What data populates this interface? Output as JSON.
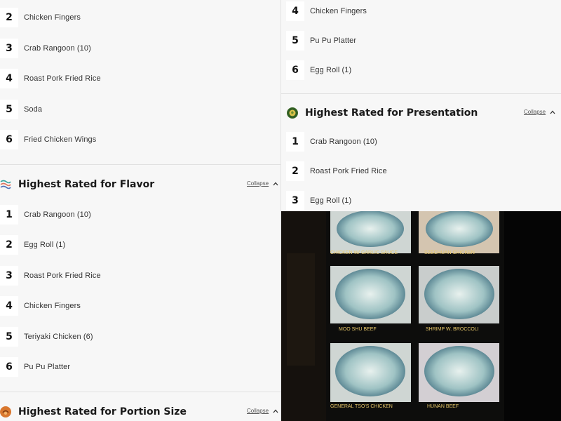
{
  "left_column": {
    "top_list": [
      {
        "rank": "2",
        "label": "Chicken Fingers"
      },
      {
        "rank": "3",
        "label": "Crab Rangoon (10)"
      },
      {
        "rank": "4",
        "label": "Roast Pork Fried Rice"
      },
      {
        "rank": "5",
        "label": "Soda"
      },
      {
        "rank": "6",
        "label": "Fried Chicken Wings"
      }
    ],
    "flavor": {
      "title": "Highest Rated for Flavor",
      "collapse_label": "Collapse",
      "icon": "flavor-icon",
      "items": [
        {
          "rank": "1",
          "label": "Crab Rangoon (10)"
        },
        {
          "rank": "2",
          "label": "Egg Roll (1)"
        },
        {
          "rank": "3",
          "label": "Roast Pork Fried Rice"
        },
        {
          "rank": "4",
          "label": "Chicken Fingers"
        },
        {
          "rank": "5",
          "label": "Teriyaki Chicken (6)"
        },
        {
          "rank": "6",
          "label": "Pu Pu Platter"
        }
      ]
    },
    "portion": {
      "title": "Highest Rated for Portion Size",
      "collapse_label": "Collapse",
      "icon": "portion-icon"
    }
  },
  "right_column": {
    "top_list": [
      {
        "rank": "4",
        "label": "Chicken Fingers"
      },
      {
        "rank": "5",
        "label": "Pu Pu Platter"
      },
      {
        "rank": "6",
        "label": "Egg Roll (1)"
      }
    ],
    "presentation": {
      "title": "Highest Rated for Presentation",
      "collapse_label": "Collapse",
      "icon": "presentation-icon",
      "items": [
        {
          "rank": "1",
          "label": "Crab Rangoon (10)"
        },
        {
          "rank": "2",
          "label": "Roast Pork Fried Rice"
        },
        {
          "rank": "3",
          "label": "Egg Roll (1)"
        }
      ]
    }
  },
  "photo": {
    "menu_labels": [
      "CHICKEN W/ GARLIC SAUCE",
      "SZECHUAN CHICKEN",
      "MOO SHU BEEF",
      "SHRIMP W. BROCCOLI",
      "GENERAL TSO'S CHICKEN",
      "HUNAN BEEF"
    ]
  },
  "colors": {
    "background": "#f7f7f7",
    "rank_box": "#ffffff",
    "divider": "#e1e1e1",
    "photo_bg": "#0a0908"
  }
}
